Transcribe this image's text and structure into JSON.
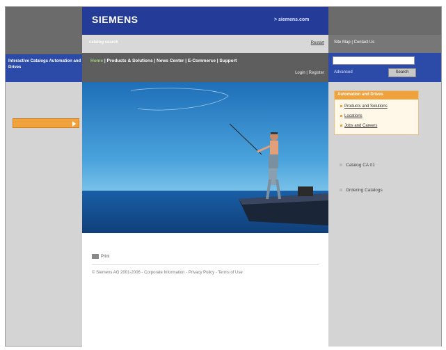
{
  "header": {
    "logo": "SIEMENS",
    "site_link": "> siemens.com",
    "search_caption": "catalog search",
    "restart": "Restart",
    "utility_links": "Site Map | Contact Us"
  },
  "left_nav": {
    "title": "Interactive Catalogs Automation and Drives"
  },
  "main_nav": {
    "items": [
      "Home",
      "Products & Solutions",
      "News Center",
      "E-Commerce",
      "Support"
    ],
    "login": "Login | Register"
  },
  "search": {
    "input_value": "",
    "advanced_label": "Advanced",
    "button_label": "Search"
  },
  "right_panel": {
    "box_title": "Automation and Drives",
    "box_items": [
      "Products and Solutions",
      "Locations",
      "Jobs and Careers"
    ],
    "links": [
      "Catalog CA 01",
      "Ordering Catalogs"
    ]
  },
  "content": {
    "print_label": "Print",
    "footer": "© Siemens AG 2001-2006 - Corporate Information - Privacy Policy - Terms of Use"
  },
  "colors": {
    "brand_blue": "#243b97",
    "nav_blue": "#2c4aa8",
    "accent_orange": "#f0a23c",
    "nav_gray": "#5e5e5e"
  }
}
